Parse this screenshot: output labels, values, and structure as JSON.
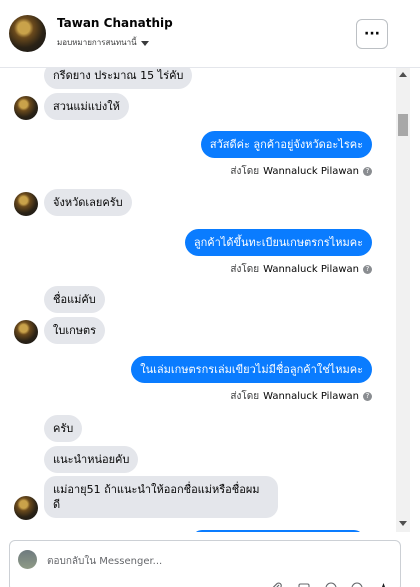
{
  "header": {
    "name": "Tawan Chanathip",
    "subtitle": "มอบหมายการสนทนานี้",
    "more_label": "···"
  },
  "messages": [
    {
      "dir": "in",
      "text": "กรีดยาง ประมาณ 15 ไร่คับ"
    },
    {
      "dir": "in",
      "text": "สวนแม่แบ่งให้"
    },
    {
      "dir": "out",
      "text": "สวัสดีค่ะ ลูกค้าอยู่จังหวัดอะไรคะ"
    },
    {
      "dir": "in",
      "text": "จังหวัดเลยครับ"
    },
    {
      "dir": "out",
      "text": "ลูกค้าได้ขึ้นทะเบียนเกษตรกรไหมคะ"
    },
    {
      "dir": "in",
      "text": "ชื่อแม่คับ"
    },
    {
      "dir": "in",
      "text": "ใบเกษตร"
    },
    {
      "dir": "out",
      "text": "ในเล่มเกษตรกรเล่มเขียวไม่มีชื่อลูกค้าใช่ไหมคะ"
    },
    {
      "dir": "in",
      "text": "ครับ"
    },
    {
      "dir": "in",
      "text": "แนะนำหน่อยคับ"
    },
    {
      "dir": "in",
      "text": "แม่อายุ51 ถ้าแนะนำให้ออกชื่อแม่หรือชื่อผม"
    },
    {
      "dir": "in",
      "text": "ดี"
    }
  ],
  "sent_by": {
    "prefix": "ส่งโดย",
    "name": "Wannaluck Pilawan",
    "icon": "question-circle-icon"
  },
  "composer": {
    "placeholder": "ตอบกลับใน Messenger..."
  },
  "colors": {
    "outgoing": "#0a7cff",
    "incoming": "#e4e6eb"
  }
}
